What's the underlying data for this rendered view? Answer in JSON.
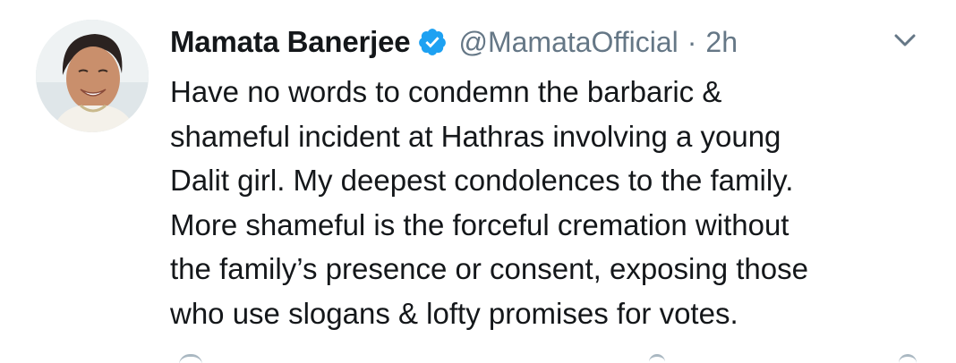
{
  "tweet": {
    "author_name": "Mamata Banerjee",
    "handle": "@MamataOfficial",
    "separator": "·",
    "time": "2h",
    "verified_icon": "verified-badge-icon",
    "menu_icon": "chevron-down-icon",
    "text_lines": [
      "Have no words to condemn the barbaric &",
      "shameful incident at Hathras involving a young",
      "Dalit girl. My deepest condolences to the family.",
      "More shameful is the forceful cremation without",
      "the family’s presence or consent, exposing those",
      "who use slogans & lofty promises for votes."
    ]
  },
  "colors": {
    "text": "#14171a",
    "secondary": "#657786",
    "verified": "#1da1f2",
    "background": "#ffffff"
  }
}
